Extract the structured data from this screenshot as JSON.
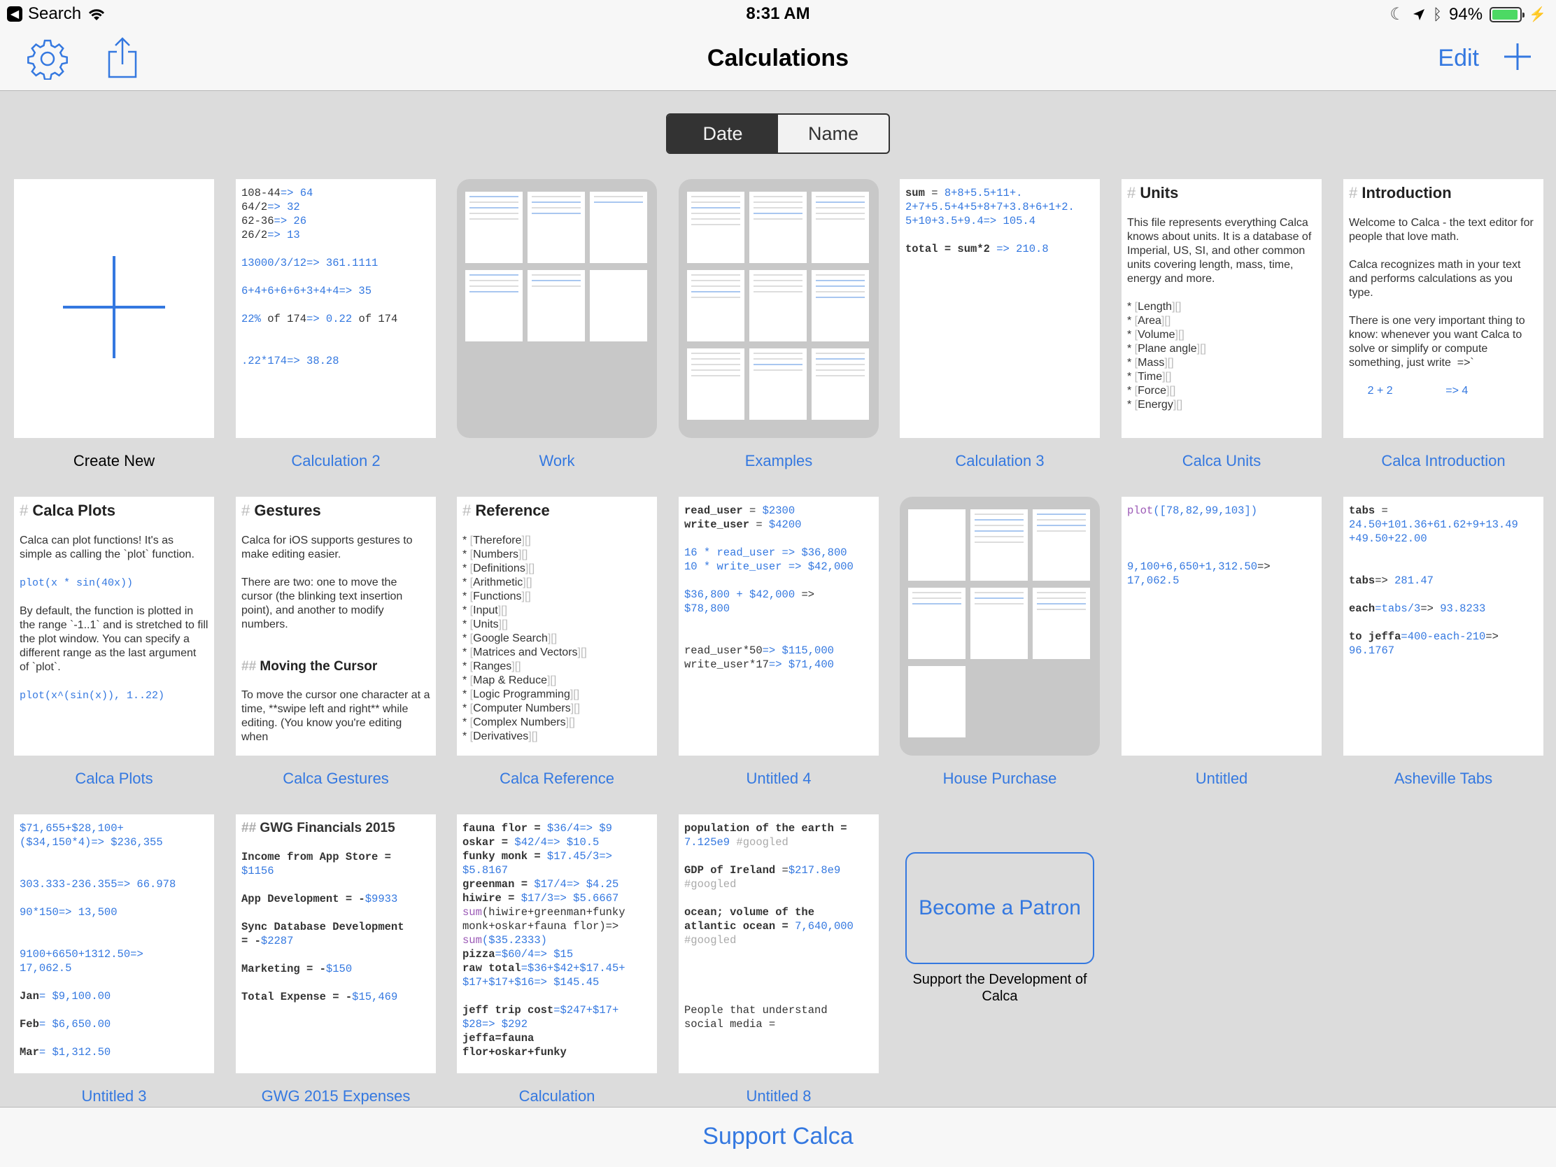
{
  "status": {
    "back_label": "Search",
    "time": "8:31 AM",
    "battery": "94%",
    "battery_level": 0.94
  },
  "nav": {
    "title": "Calculations",
    "edit_label": "Edit"
  },
  "sort": {
    "options": [
      "Date",
      "Name"
    ],
    "selected": "Date"
  },
  "cards": {
    "create_new": "Create New",
    "calc2": "Calculation 2",
    "work": "Work",
    "examples": "Examples",
    "calc3": "Calculation 3",
    "units": "Calca Units",
    "intro": "Calca Introduction",
    "plots": "Calca Plots",
    "gestures": "Calca Gestures",
    "reference": "Calca Reference",
    "untitled4": "Untitled 4",
    "house": "House Purchase",
    "untitled": "Untitled",
    "asheville": "Asheville Tabs",
    "untitled3": "Untitled 3",
    "gwg": "GWG 2015 Expenses",
    "calculation": "Calculation",
    "untitled8": "Untitled 8"
  },
  "previews": {
    "calc2": [
      "108-44",
      "=> 64",
      "64/2",
      "=> 32",
      "62-36",
      "=> 26",
      "26/2",
      "=> 13",
      "13000/3/12",
      "=> 361.1111",
      "6+4+6+6+6+3+4+4",
      "=> 35",
      "22%",
      " of 174",
      "=> 0.22",
      " of 174",
      ".22*174",
      "=> 38.28"
    ],
    "calc3": [
      "sum",
      " = ",
      "8+8+5.5+11+.\n2+7+5.5+4+5+8+7+3.8+6+1+2.\n5+10+3.5+9.4",
      "=> 105.4",
      "total",
      " = sum*2 ",
      "=> 210.8"
    ],
    "units": {
      "title": "Units",
      "body": "This file represents everything Calca knows about units. It is a database of Imperial, US, SI, and other common units covering length, mass, time, energy and more.",
      "items": [
        "Length",
        "Area",
        "Volume",
        "Plane angle",
        "Mass",
        "Time",
        "Force",
        "Energy"
      ]
    },
    "intro": {
      "title": "Introduction",
      "p1": "Welcome to Calca - the text editor for people that love math.",
      "p2": "Calca recognizes math in your text and performs calculations as you type.",
      "p3": "There is one very important thing to know: whenever you want Calca to solve or simplify or compute something, just write  =>`",
      "expr": "2 + 2",
      "arrow": "=> 4"
    },
    "plots": {
      "title": "Calca Plots",
      "p1": "Calca can plot functions! It's as simple as calling the `plot` function.",
      "code1": "plot(x * sin(40x))",
      "p2": "By default, the function is plotted in the range `-1..1` and is stretched to fill the plot window. You can specify a different range as the last argument of `plot`.",
      "code2": "plot(x^(sin(x)), 1..22)"
    },
    "gestures": {
      "title": "Gestures",
      "p1": "Calca for iOS supports gestures to make editing easier.",
      "p2": "There are two: one to move the cursor (the blinking text insertion point), and another to modify numbers.",
      "h2": "Moving the Cursor",
      "p3": "To move the cursor one character at a time, **swipe left and right** while editing. (You know you're editing when"
    },
    "reference": {
      "title": "Reference",
      "items": [
        "Therefore",
        "Numbers",
        "Definitions",
        "Arithmetic",
        "Functions",
        "Input",
        "Units",
        "Google Search",
        "Matrices and Vectors",
        "Ranges",
        "Map & Reduce",
        "Logic Programming",
        "Computer Numbers",
        "Complex Numbers",
        "Derivatives"
      ]
    },
    "untitled4": [
      "read_user",
      " = ",
      "$2300",
      "write_user",
      " = ",
      "$4200",
      "16 * read_user",
      " => ",
      "$36,800",
      "10 * write_user",
      " => ",
      "$42,000",
      "$36,800 + $42,000",
      " =>\n",
      "$78,800",
      "read_user*50",
      "=> ",
      "$115,000",
      "write_user*17",
      "=> ",
      "$71,400"
    ],
    "untitled": [
      "plot",
      "([78,82,99,103])",
      "9,100+6,650+1,312.50",
      "=>\n",
      "17,062.5"
    ],
    "asheville": [
      "tabs",
      " =\n",
      "24.50+101.36+61.62+9+13.49\n+49.50+22.00",
      "tabs",
      "=> ",
      "281.47",
      "each",
      "=tabs/3",
      "=> ",
      "93.8233",
      "to jeffa",
      "=400-each-210",
      "=>\n",
      "96.1767"
    ],
    "untitled3": [
      "$71,655+$28,100+\n($34,150*4)",
      "=> $236,355",
      "303.333-236.355",
      "=> 66.978",
      "90*150",
      "=> 13,500",
      "9100+6650+1312.50",
      "=>\n17,062.5",
      "Jan",
      "= $9,100.00",
      "Feb",
      "= $6,650.00",
      "Mar",
      "= $1,312.50"
    ],
    "gwg": {
      "title": "GWG Financials 2015",
      "lines": [
        "Income from App Store =",
        "$1156",
        "App Development = -",
        "$9933",
        "Sync Database Development\n= -",
        "$2287",
        "Marketing = -",
        "$150",
        "Total Expense = -",
        "$15,469"
      ]
    },
    "calculation": [
      "fauna flor = ",
      "$36/4",
      "=> $9",
      "oskar = ",
      "$42/4",
      "=> $10.5",
      "funky monk = ",
      "$17.45/3",
      "=>\n$5.8167",
      "greenman = ",
      "$17/4",
      "=> $4.25",
      "hiwire = ",
      "$17/3",
      "=> $5.6667",
      "sum",
      "(hiwire+greenman+funky\nmonk+oskar+fauna flor)=>\n",
      "sum",
      "($35.2333)",
      "pizza",
      "=$60/4",
      "=> $15",
      "raw total",
      "=$36+$42+$17.45+\n$17+$17+$16",
      "=> $145.45",
      "jeff trip cost",
      "=$247+$17+\n$28",
      "=> $292",
      "jeffa=fauna\nflor+oskar+funky"
    ],
    "untitled8": [
      "population of the earth =\n",
      "7.125e9",
      " #googled",
      "GDP of Ireland",
      " =",
      "$217.8e9",
      "\n#googled",
      "ocean; volume of the\natlantic ocean",
      " = ",
      "7,640,000",
      "\n#googled",
      "People that understand\nsocial media ="
    ]
  },
  "patron": {
    "button": "Become a Patron",
    "subtitle": "Support the Development of Calca"
  },
  "footer": {
    "support": "Support Calca"
  },
  "colors": {
    "accent": "#3478e0",
    "background": "#dcdcdc",
    "bar": "#f7f7f7"
  },
  "icons": [
    "back-arrow-icon",
    "wifi-icon",
    "moon-icon",
    "location-icon",
    "bluetooth-icon",
    "battery-icon",
    "gear-icon",
    "share-icon",
    "plus-icon"
  ]
}
